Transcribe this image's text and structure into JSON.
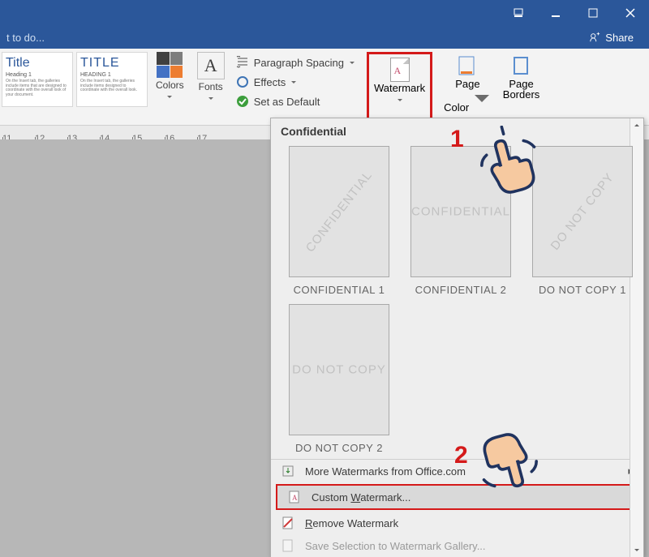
{
  "window": {
    "min": "",
    "max": "",
    "close": ""
  },
  "header": {
    "tellme": "t to do...",
    "share": "Share"
  },
  "ribbon": {
    "style1": {
      "title": "Title",
      "heading": "Heading 1"
    },
    "style2": {
      "title": "TITLE",
      "heading": "HEADING 1"
    },
    "colors": "Colors",
    "fonts": "Fonts",
    "paragraph": "Paragraph Spacing",
    "effects": "Effects",
    "setdefault": "Set as Default",
    "watermark": "Watermark",
    "pagecolor": "Page",
    "pagecolor2": "Color",
    "pageborders": "Page",
    "pageborders2": "Borders"
  },
  "ruler": [
    "11",
    "12",
    "13",
    "14",
    "15",
    "16",
    "17"
  ],
  "gallery": {
    "header": "Confidential",
    "items": [
      {
        "wm": "CONFIDENTIAL",
        "diag": true,
        "cap": "CONFIDENTIAL 1"
      },
      {
        "wm": "CONFIDENTIAL",
        "diag": false,
        "cap": "CONFIDENTIAL 2"
      },
      {
        "wm": "DO NOT COPY",
        "diag": true,
        "cap": "DO NOT COPY 1"
      },
      {
        "wm": "DO NOT COPY",
        "diag": false,
        "cap": "DO NOT COPY 2"
      }
    ],
    "more": "More Watermarks from Office.com",
    "custom_pre": "Custom ",
    "custom_u": "W",
    "custom_post": "atermark...",
    "remove_pre": "",
    "remove_u": "R",
    "remove_post": "emove Watermark",
    "save": "Save Selection to Watermark Gallery..."
  },
  "annot": {
    "n1": "1",
    "n2": "2"
  }
}
